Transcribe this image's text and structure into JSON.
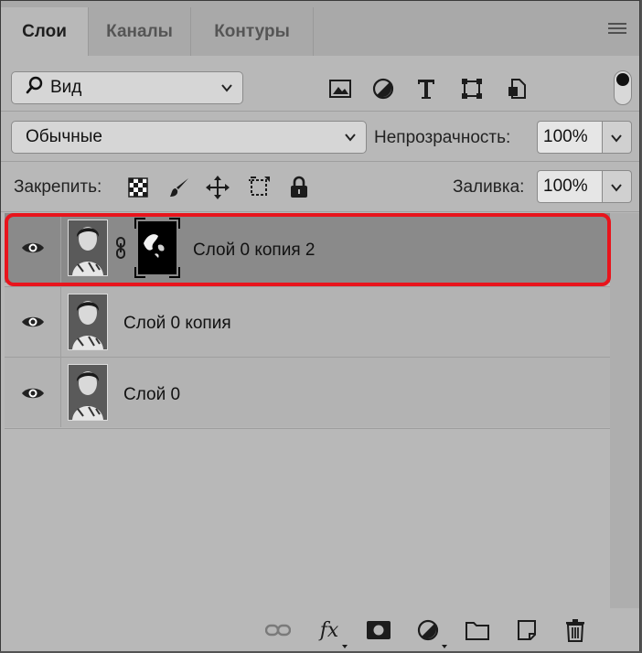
{
  "tabs": [
    {
      "label": "Слои",
      "active": true
    },
    {
      "label": "Каналы",
      "active": false
    },
    {
      "label": "Контуры",
      "active": false
    }
  ],
  "filter": {
    "value": "Вид",
    "search_glyph": "⌕"
  },
  "filter_tools": [
    "image-filter-icon",
    "adjustment-filter-icon",
    "text-filter-icon",
    "shape-filter-icon",
    "smart-object-filter-icon"
  ],
  "blend_mode": {
    "value": "Обычные"
  },
  "opacity": {
    "label": "Непрозрачность:",
    "value": "100%"
  },
  "lock": {
    "label": "Закрепить:"
  },
  "fill": {
    "label": "Заливка:",
    "value": "100%"
  },
  "layers": [
    {
      "name": "Слой 0 копия 2",
      "selected": true,
      "has_mask": true
    },
    {
      "name": "Слой 0 копия",
      "selected": false,
      "has_mask": false
    },
    {
      "name": "Слой 0",
      "selected": false,
      "has_mask": false
    }
  ],
  "colors": {
    "highlight": "#e8141c",
    "selected_row": "#8a8a8a",
    "row": "#b3b3b3"
  },
  "bottom_tools": [
    "link-layers-icon",
    "fx-icon",
    "add-mask-icon",
    "adjustment-layer-icon",
    "new-group-icon",
    "new-layer-icon",
    "delete-layer-icon"
  ],
  "fx_label": "fx"
}
